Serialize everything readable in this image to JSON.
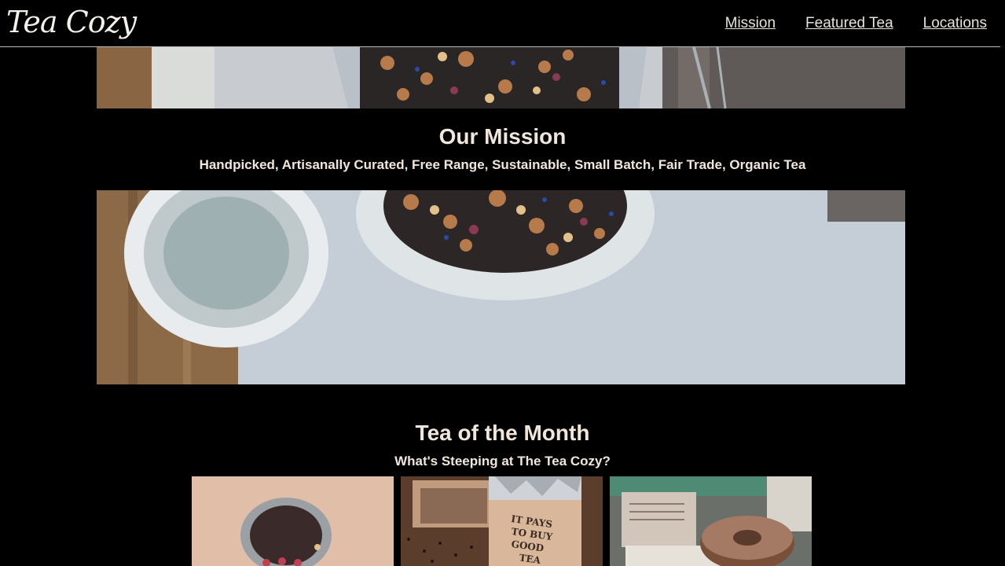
{
  "header": {
    "logo": "Tea Cozy",
    "nav": [
      {
        "label": "Mission"
      },
      {
        "label": "Featured Tea"
      },
      {
        "label": "Locations"
      }
    ]
  },
  "mission": {
    "title": "Our Mission",
    "subtitle": "Handpicked, Artisanally Curated, Free Range, Sustainable, Small Batch, Fair Trade, Organic Tea"
  },
  "tea_of_month": {
    "title": "Tea of the Month",
    "subtitle": "What's Steeping at The Tea Cozy?",
    "box_text": "IT PAYS TO BUY GOOD TEA"
  },
  "colors": {
    "background": "#000000",
    "text": "#f0e6dc"
  }
}
